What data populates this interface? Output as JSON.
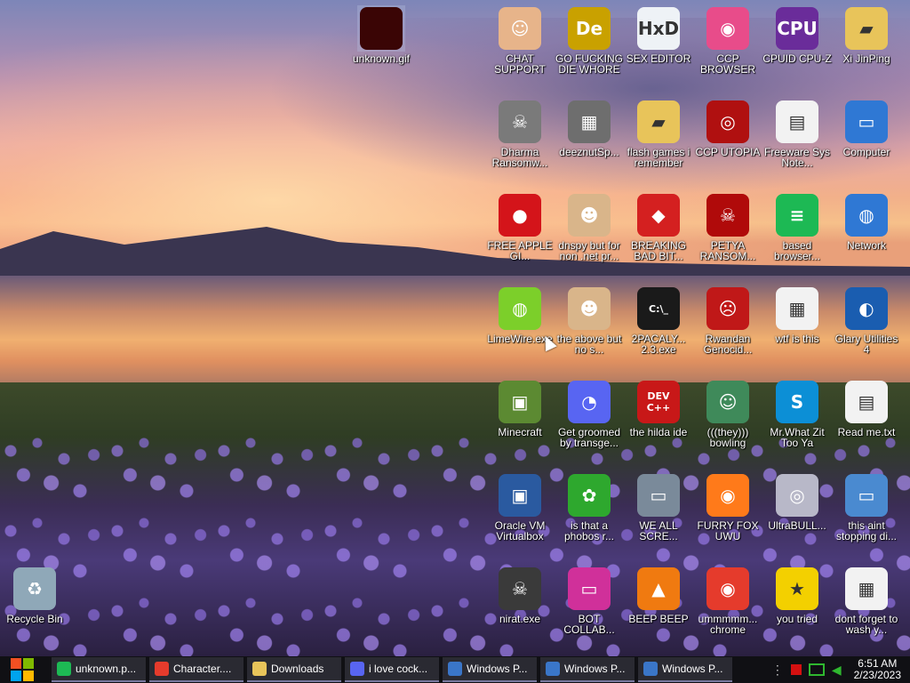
{
  "icons": [
    {
      "label": "unknown.gif",
      "glyph": "",
      "color": "#3a0505"
    },
    {
      "label": "CHAT SUPPORT",
      "glyph": "☺",
      "color": "#e7b48a"
    },
    {
      "label": "GO FUCKING DIE WHORE",
      "glyph": "De",
      "color": "#c9a100"
    },
    {
      "label": "SEX EDITOR",
      "glyph": "HxD",
      "color": "#eef2f6"
    },
    {
      "label": "CCP BROWSER",
      "glyph": "◉",
      "color": "#e84c8a"
    },
    {
      "label": "CPUID CPU-Z",
      "glyph": "CPU",
      "color": "#6a2c9a"
    },
    {
      "label": "Xi JinPing",
      "glyph": "▰",
      "color": "#e8c45a"
    },
    {
      "label": "Dharma Ransomw...",
      "glyph": "☠",
      "color": "#7a7a7a"
    },
    {
      "label": "deeznutSp...",
      "glyph": "▦",
      "color": "#6e6e6e"
    },
    {
      "label": "flash games i remember",
      "glyph": "▰",
      "color": "#e8c45a"
    },
    {
      "label": "CCP UTOPIA",
      "glyph": "◎",
      "color": "#b01010"
    },
    {
      "label": "Freeware Sys Note...",
      "glyph": "▤",
      "color": "#f2f2f2"
    },
    {
      "label": "Computer",
      "glyph": "▭",
      "color": "#2f78d4"
    },
    {
      "label": "FREE APPLE GI...",
      "glyph": "●",
      "color": "#d4141a"
    },
    {
      "label": "dnspy but for non .net pr...",
      "glyph": "☻",
      "color": "#d9b58a"
    },
    {
      "label": "BREAKING BAD BIT...",
      "glyph": "◆",
      "color": "#d42020"
    },
    {
      "label": "PETYA RANSOM...",
      "glyph": "☠",
      "color": "#b00a0a"
    },
    {
      "label": "based browser...",
      "glyph": "≡",
      "color": "#1db954"
    },
    {
      "label": "Network",
      "glyph": "◍",
      "color": "#2f78d4"
    },
    {
      "label": "LimeWire.exe",
      "glyph": "◍",
      "color": "#7ccf2a"
    },
    {
      "label": "the above but no s...",
      "glyph": "☻",
      "color": "#d9b58a"
    },
    {
      "label": "2PACALY... 2.3.exe",
      "glyph": "C:\\_",
      "color": "#1a1a1a"
    },
    {
      "label": "Rwandan Genocid...",
      "glyph": "☹",
      "color": "#c01818"
    },
    {
      "label": "wtf is this",
      "glyph": "▦",
      "color": "#f2f2f2"
    },
    {
      "label": "Glary Utilities 4",
      "glyph": "◐",
      "color": "#1a5db0"
    },
    {
      "label": "Minecraft",
      "glyph": "▣",
      "color": "#5c8a32"
    },
    {
      "label": "Get groomed by transge...",
      "glyph": "◔",
      "color": "#5865f2"
    },
    {
      "label": "the hilda ide",
      "glyph": "DEV C++",
      "color": "#c81818"
    },
    {
      "label": "(((they))) bowling",
      "glyph": "☺",
      "color": "#3f8a5a"
    },
    {
      "label": "Mr.What Zit Too Ya",
      "glyph": "S",
      "color": "#0c8fd6"
    },
    {
      "label": "Read me.txt",
      "glyph": "▤",
      "color": "#f2f2f2"
    },
    {
      "label": "Oracle VM Virtualbox",
      "glyph": "▣",
      "color": "#2a5aa0"
    },
    {
      "label": "is that a phobos r...",
      "glyph": "✿",
      "color": "#2ea82e"
    },
    {
      "label": "WE ALL SCRE...",
      "glyph": "▭",
      "color": "#7a8a9a"
    },
    {
      "label": "FURRY FOX UWU",
      "glyph": "◉",
      "color": "#ff7a1a"
    },
    {
      "label": "UltraBULL...",
      "glyph": "◎",
      "color": "#b8b8c8"
    },
    {
      "label": "this aint stopping di...",
      "glyph": "▭",
      "color": "#4a8ad0"
    },
    {
      "label": "Recycle Bin",
      "glyph": "♻",
      "color": "#8fa8b8"
    },
    {
      "label": "nirat.exe",
      "glyph": "☠",
      "color": "#3a3a3a"
    },
    {
      "label": "BOT COLLAB...",
      "glyph": "▭",
      "color": "#d0309a"
    },
    {
      "label": "BEEP BEEP",
      "glyph": "▲",
      "color": "#f07a10"
    },
    {
      "label": "ummmmm... chrome",
      "glyph": "◉",
      "color": "#e53b2c"
    },
    {
      "label": "you tried",
      "glyph": "★",
      "color": "#f3d000"
    },
    {
      "label": "dont forget to wash y...",
      "glyph": "▦",
      "color": "#f2f2f2"
    }
  ],
  "taskbar": {
    "items": [
      {
        "label": "unknown.p...",
        "icon": "spotify-icon",
        "color": "#1db954"
      },
      {
        "label": "Character....",
        "icon": "chrome-icon",
        "color": "#e53b2c"
      },
      {
        "label": "Downloads",
        "icon": "folder-icon",
        "color": "#e8c45a"
      },
      {
        "label": "i love cock...",
        "icon": "discord-icon",
        "color": "#5865f2"
      },
      {
        "label": "Windows P...",
        "icon": "window-icon",
        "color": "#3a76c8"
      },
      {
        "label": "Windows P...",
        "icon": "window-icon",
        "color": "#3a76c8"
      },
      {
        "label": "Windows P...",
        "icon": "window-icon",
        "color": "#3a76c8"
      }
    ],
    "clock": {
      "time": "6:51 AM",
      "date": "2/23/2023"
    }
  }
}
